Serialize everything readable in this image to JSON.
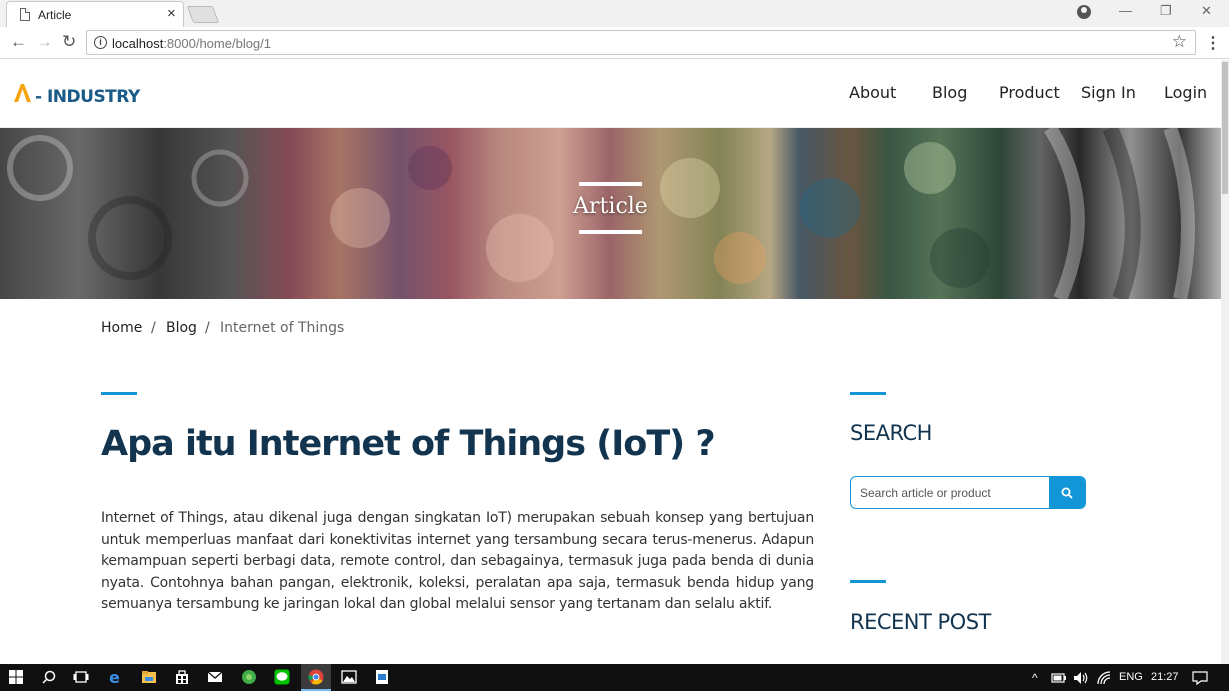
{
  "browser": {
    "tab_title": "Article",
    "tab_close": "×",
    "url_host": "localhost",
    "url_path": ":8000/home/blog/1",
    "back": "←",
    "forward": "→",
    "reload": "↻",
    "star": "☆",
    "menu": "⋮",
    "minimize": "—",
    "restore": "❐",
    "close": "✕"
  },
  "header": {
    "logo_text": "- INDUSTRY",
    "nav": [
      "About",
      "Blog",
      "Product",
      "Sign In",
      "Login"
    ]
  },
  "hero": {
    "title": "Article"
  },
  "breadcrumb": {
    "home": "Home",
    "blog": "Blog",
    "current": "Internet of Things",
    "separator": "/"
  },
  "article": {
    "title": "Apa itu Internet of Things (IoT) ?",
    "body": "Internet of Things, atau dikenal juga dengan singkatan IoT) merupakan sebuah konsep yang bertujuan untuk memperluas manfaat dari konektivitas internet yang tersambung secara terus-menerus. Adapun kemampuan seperti berbagi data, remote control, dan sebagainya, termasuk juga pada benda di dunia nyata. Contohnya bahan pangan, elektronik, koleksi, peralatan apa saja, termasuk benda hidup yang semuanya tersambung ke jaringan lokal dan global melalui sensor yang tertanam dan selalu aktif."
  },
  "sidebar": {
    "search_heading": "SEARCH",
    "search_placeholder": "Search article or product",
    "recent_heading": "RECENT POST"
  },
  "taskbar": {
    "lang": "ENG",
    "time": "21:27"
  },
  "colors": {
    "accent": "#1296d8",
    "title": "#12344f",
    "logo": "#1a5a86",
    "logo_mark": "#f5a30b"
  }
}
